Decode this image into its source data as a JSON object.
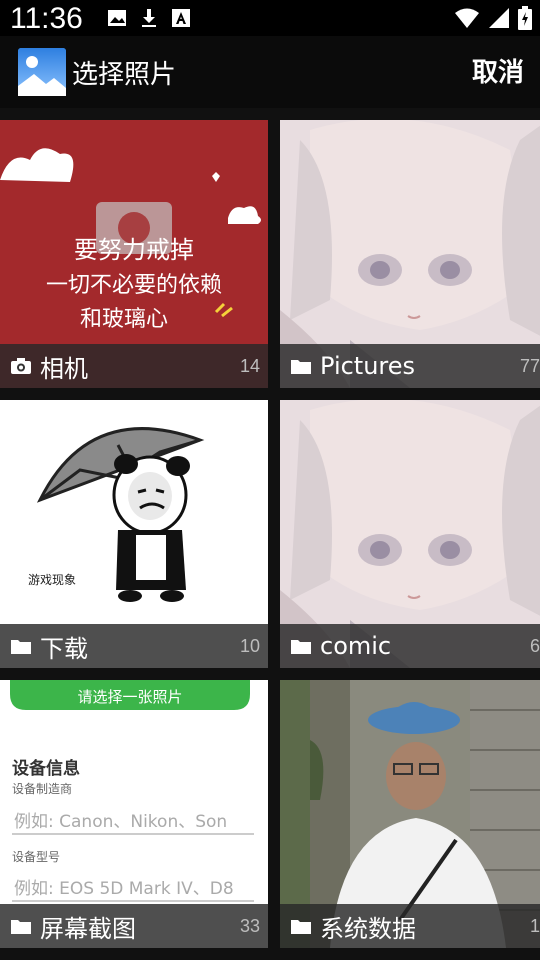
{
  "status_bar": {
    "time": "11:36",
    "icons": [
      "image-icon",
      "download-icon",
      "font-icon",
      "wifi-icon",
      "signal-icon",
      "battery-icon"
    ]
  },
  "app_bar": {
    "title": "选择照片",
    "cancel_label": "取消"
  },
  "albums": [
    {
      "name": "相机",
      "count": "14",
      "icon": "camera-icon"
    },
    {
      "name": "Pictures",
      "count": "77",
      "icon": "folder-icon"
    },
    {
      "name": "下载",
      "count": "10",
      "icon": "folder-icon"
    },
    {
      "name": "comic",
      "count": "6",
      "icon": "folder-icon"
    },
    {
      "name": "屏幕截图",
      "count": "33",
      "icon": "folder-icon"
    },
    {
      "name": "系统数据",
      "count": "1",
      "icon": "folder-icon"
    }
  ],
  "thumbnails": {
    "camera_text_lines": [
      "要努力戒掉",
      "一切不必要的依赖",
      "和玻璃心"
    ],
    "download_caption": "游戏现象",
    "screenshot": {
      "button": "请选择一张照片",
      "heading": "设备信息",
      "manufacturer_label": "设备制造商",
      "manufacturer_placeholder": "例如: Canon、Nikon、Son",
      "model_label": "设备型号",
      "model_placeholder": "例如: EOS 5D Mark IV、D8"
    }
  },
  "colors": {
    "camera_bg": "#a3292c",
    "anime_bg": "#e8dde0",
    "screenshot_button": "#3cb54a"
  }
}
